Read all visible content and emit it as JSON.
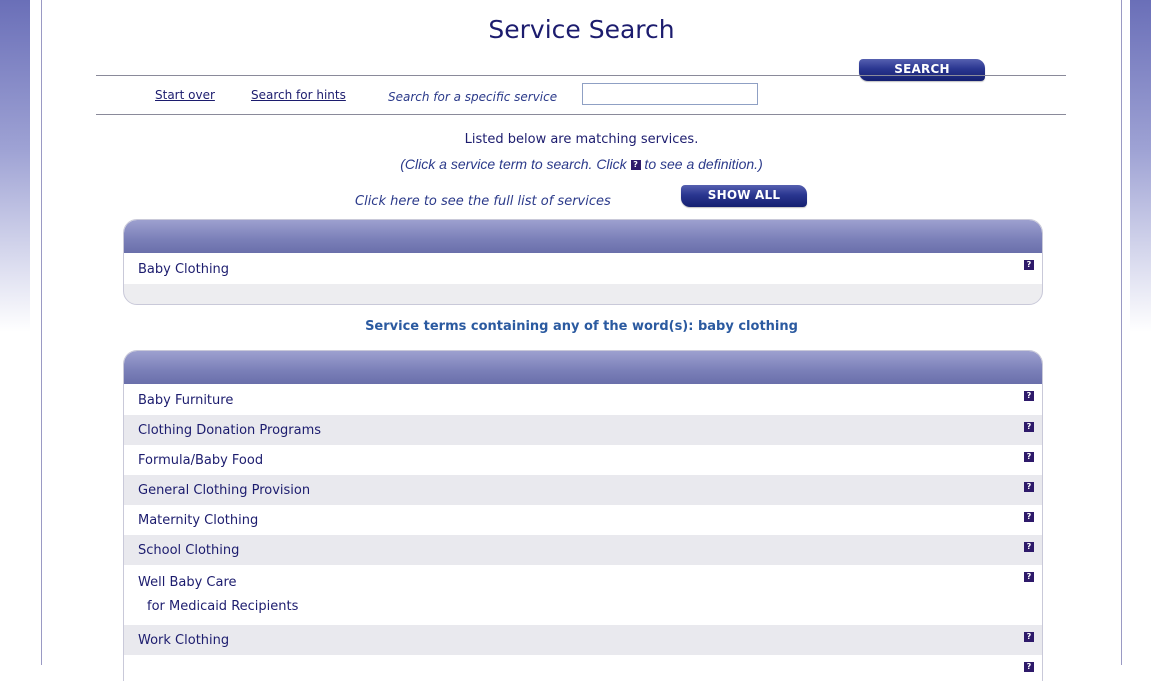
{
  "page": {
    "title": "Service Search",
    "search_button": "SEARCH",
    "start_over": "Start over",
    "search_hints": "Search for hints",
    "search_label": "Search for a specific service",
    "search_value": "",
    "info_line1": "Listed below are matching services.",
    "info_line2_pre": "(Click a service term to search. Click ",
    "info_line2_post": " to see a definition.)",
    "help_icon_glyph": "?",
    "full_list_label": "Click here to see the full list of services",
    "show_all_button": "SHOW ALL",
    "section_title": "Service terms containing any of the word(s): baby clothing"
  },
  "exact_match": [
    {
      "name": "Baby Clothing",
      "sub": ""
    }
  ],
  "related_terms": [
    {
      "name": "Baby Furniture",
      "sub": ""
    },
    {
      "name": "Clothing Donation Programs",
      "sub": ""
    },
    {
      "name": "Formula/Baby Food",
      "sub": ""
    },
    {
      "name": "General Clothing Provision",
      "sub": ""
    },
    {
      "name": "Maternity Clothing",
      "sub": ""
    },
    {
      "name": "School Clothing",
      "sub": ""
    },
    {
      "name": "Well Baby Care",
      "sub": "for Medicaid Recipients"
    },
    {
      "name": "Work Clothing",
      "sub": ""
    }
  ],
  "colors": {
    "accent": "#1c1c6e",
    "panel_header": "#7a7fb8",
    "row_alt": "#e9e9ee",
    "section_title": "#2b5aa0"
  }
}
